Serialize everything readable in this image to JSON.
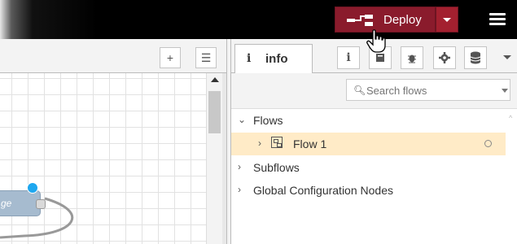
{
  "header": {
    "deploy_label": "Deploy"
  },
  "workspace": {
    "add_button": "+",
    "list_button": "☰",
    "node": {
      "label": "ge"
    }
  },
  "sidebar": {
    "active_tab": {
      "icon": "i",
      "label": "info"
    },
    "tab_icons": [
      "info-icon",
      "book-icon",
      "bug-icon",
      "gear-icon",
      "database-icon"
    ],
    "search": {
      "placeholder": "Search flows",
      "value": ""
    },
    "tree": {
      "flows_label": "Flows",
      "flow_1_label": "Flow 1",
      "subflows_label": "Subflows",
      "global_config_label": "Global Configuration Nodes"
    }
  }
}
